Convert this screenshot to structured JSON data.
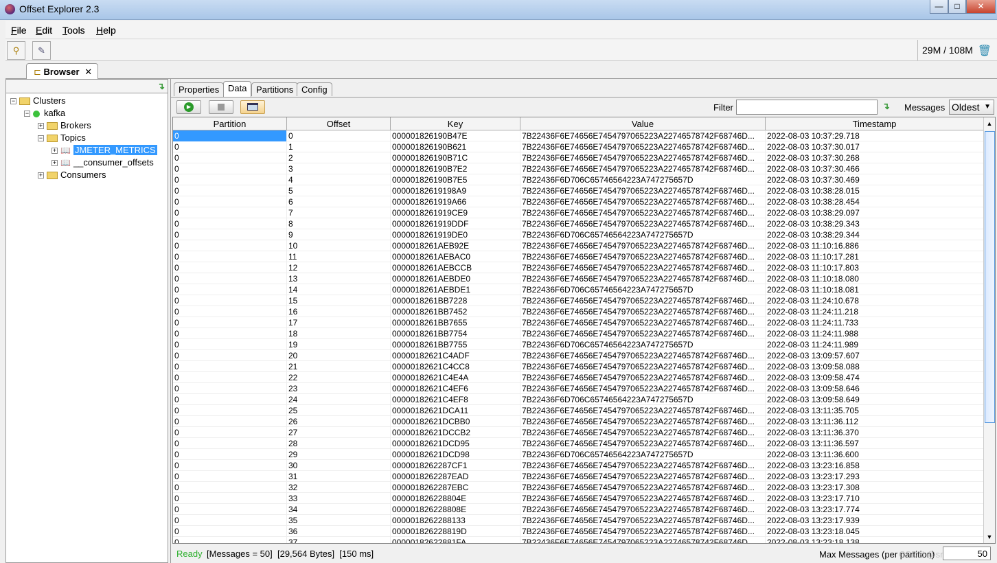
{
  "window": {
    "title": "Offset Explorer  2.3",
    "minimize": "—",
    "maximize": "□",
    "close": "✕"
  },
  "menu": [
    {
      "label": "File",
      "key": "F",
      "rest": "ile"
    },
    {
      "label": "Edit",
      "key": "E",
      "rest": "dit"
    },
    {
      "label": "Tools",
      "key": "T",
      "rest": "ools"
    },
    {
      "label": "Help",
      "key": "H",
      "rest": "elp"
    }
  ],
  "toolbar": {
    "memory": "29M / 108M"
  },
  "browser_tab": {
    "label": "Browser",
    "close": "✕"
  },
  "tree": {
    "clusters": "Clusters",
    "cluster": "kafka",
    "brokers": "Brokers",
    "topics": "Topics",
    "topic_selected": "JMETER_METRICS",
    "topic_other": "__consumer_offsets",
    "consumers": "Consumers",
    "status_color": "#3cc23c"
  },
  "tabs": [
    "Properties",
    "Data",
    "Partitions",
    "Config"
  ],
  "active_tab": "Data",
  "controls": {
    "filter_label": "Filter",
    "filter_value": "",
    "messages_label": "Messages",
    "messages_value": "Oldest"
  },
  "table": {
    "columns": [
      "Partition",
      "Offset",
      "Key",
      "Value",
      "Timestamp"
    ],
    "rows": [
      [
        "0",
        "0",
        "000001826190B47E",
        "7B22436F6E74656E7454797065223A22746578742F68746D...",
        "2022-08-03 10:37:29.718"
      ],
      [
        "0",
        "1",
        "000001826190B621",
        "7B22436F6E74656E7454797065223A22746578742F68746D...",
        "2022-08-03 10:37:30.017"
      ],
      [
        "0",
        "2",
        "000001826190B71C",
        "7B22436F6E74656E7454797065223A22746578742F68746D...",
        "2022-08-03 10:37:30.268"
      ],
      [
        "0",
        "3",
        "000001826190B7E2",
        "7B22436F6E74656E7454797065223A22746578742F68746D...",
        "2022-08-03 10:37:30.466"
      ],
      [
        "0",
        "4",
        "000001826190B7E5",
        "7B22436F6D706C65746564223A747275657D",
        "2022-08-03 10:37:30.469"
      ],
      [
        "0",
        "5",
        "00000182619198A9",
        "7B22436F6E74656E7454797065223A22746578742F68746D...",
        "2022-08-03 10:38:28.015"
      ],
      [
        "0",
        "6",
        "0000018261919A66",
        "7B22436F6E74656E7454797065223A22746578742F68746D...",
        "2022-08-03 10:38:28.454"
      ],
      [
        "0",
        "7",
        "0000018261919CE9",
        "7B22436F6E74656E7454797065223A22746578742F68746D...",
        "2022-08-03 10:38:29.097"
      ],
      [
        "0",
        "8",
        "0000018261919DDF",
        "7B22436F6E74656E7454797065223A22746578742F68746D...",
        "2022-08-03 10:38:29.343"
      ],
      [
        "0",
        "9",
        "0000018261919DE0",
        "7B22436F6D706C65746564223A747275657D",
        "2022-08-03 10:38:29.344"
      ],
      [
        "0",
        "10",
        "0000018261AEB92E",
        "7B22436F6E74656E7454797065223A22746578742F68746D...",
        "2022-08-03 11:10:16.886"
      ],
      [
        "0",
        "11",
        "0000018261AEBAC0",
        "7B22436F6E74656E7454797065223A22746578742F68746D...",
        "2022-08-03 11:10:17.281"
      ],
      [
        "0",
        "12",
        "0000018261AEBCCB",
        "7B22436F6E74656E7454797065223A22746578742F68746D...",
        "2022-08-03 11:10:17.803"
      ],
      [
        "0",
        "13",
        "0000018261AEBDE0",
        "7B22436F6E74656E7454797065223A22746578742F68746D...",
        "2022-08-03 11:10:18.080"
      ],
      [
        "0",
        "14",
        "0000018261AEBDE1",
        "7B22436F6D706C65746564223A747275657D",
        "2022-08-03 11:10:18.081"
      ],
      [
        "0",
        "15",
        "0000018261BB7228",
        "7B22436F6E74656E7454797065223A22746578742F68746D...",
        "2022-08-03 11:24:10.678"
      ],
      [
        "0",
        "16",
        "0000018261BB7452",
        "7B22436F6E74656E7454797065223A22746578742F68746D...",
        "2022-08-03 11:24:11.218"
      ],
      [
        "0",
        "17",
        "0000018261BB7655",
        "7B22436F6E74656E7454797065223A22746578742F68746D...",
        "2022-08-03 11:24:11.733"
      ],
      [
        "0",
        "18",
        "0000018261BB7754",
        "7B22436F6E74656E7454797065223A22746578742F68746D...",
        "2022-08-03 11:24:11.988"
      ],
      [
        "0",
        "19",
        "0000018261BB7755",
        "7B22436F6D706C65746564223A747275657D",
        "2022-08-03 11:24:11.989"
      ],
      [
        "0",
        "20",
        "00000182621C4ADF",
        "7B22436F6E74656E7454797065223A22746578742F68746D...",
        "2022-08-03 13:09:57.607"
      ],
      [
        "0",
        "21",
        "00000182621C4CC8",
        "7B22436F6E74656E7454797065223A22746578742F68746D...",
        "2022-08-03 13:09:58.088"
      ],
      [
        "0",
        "22",
        "00000182621C4E4A",
        "7B22436F6E74656E7454797065223A22746578742F68746D...",
        "2022-08-03 13:09:58.474"
      ],
      [
        "0",
        "23",
        "00000182621C4EF6",
        "7B22436F6E74656E7454797065223A22746578742F68746D...",
        "2022-08-03 13:09:58.646"
      ],
      [
        "0",
        "24",
        "00000182621C4EF8",
        "7B22436F6D706C65746564223A747275657D",
        "2022-08-03 13:09:58.649"
      ],
      [
        "0",
        "25",
        "00000182621DCA11",
        "7B22436F6E74656E7454797065223A22746578742F68746D...",
        "2022-08-03 13:11:35.705"
      ],
      [
        "0",
        "26",
        "00000182621DCBB0",
        "7B22436F6E74656E7454797065223A22746578742F68746D...",
        "2022-08-03 13:11:36.112"
      ],
      [
        "0",
        "27",
        "00000182621DCCB2",
        "7B22436F6E74656E7454797065223A22746578742F68746D...",
        "2022-08-03 13:11:36.370"
      ],
      [
        "0",
        "28",
        "00000182621DCD95",
        "7B22436F6E74656E7454797065223A22746578742F68746D...",
        "2022-08-03 13:11:36.597"
      ],
      [
        "0",
        "29",
        "00000182621DCD98",
        "7B22436F6D706C65746564223A747275657D",
        "2022-08-03 13:11:36.600"
      ],
      [
        "0",
        "30",
        "0000018262287CF1",
        "7B22436F6E74656E7454797065223A22746578742F68746D...",
        "2022-08-03 13:23:16.858"
      ],
      [
        "0",
        "31",
        "0000018262287EAD",
        "7B22436F6E74656E7454797065223A22746578742F68746D...",
        "2022-08-03 13:23:17.293"
      ],
      [
        "0",
        "32",
        "0000018262287EBC",
        "7B22436F6E74656E7454797065223A22746578742F68746D...",
        "2022-08-03 13:23:17.308"
      ],
      [
        "0",
        "33",
        "000001826228804E",
        "7B22436F6E74656E7454797065223A22746578742F68746D...",
        "2022-08-03 13:23:17.710"
      ],
      [
        "0",
        "34",
        "000001826228808E",
        "7B22436F6E74656E7454797065223A22746578742F68746D...",
        "2022-08-03 13:23:17.774"
      ],
      [
        "0",
        "35",
        "0000018262288133",
        "7B22436F6E74656E7454797065223A22746578742F68746D...",
        "2022-08-03 13:23:17.939"
      ],
      [
        "0",
        "36",
        "000001826228819D",
        "7B22436F6E74656E7454797065223A22746578742F68746D...",
        "2022-08-03 13:23:18.045"
      ],
      [
        "0",
        "37",
        "00000182622881FA",
        "7B22436F6E74656E7454797065223A22746578742F68746D...",
        "2022-08-03 13:23:18.138"
      ]
    ],
    "selected_row": 0
  },
  "status": {
    "ready": "Ready",
    "info": "[Messages = 50]  [29,564 Bytes]  [150 ms]",
    "max_label": "Max Messages (per partition)",
    "max_value": "50",
    "watermark": "CSDN @smooth"
  },
  "colors": {
    "selection": "#3399ff",
    "ready": "#2db02d"
  }
}
